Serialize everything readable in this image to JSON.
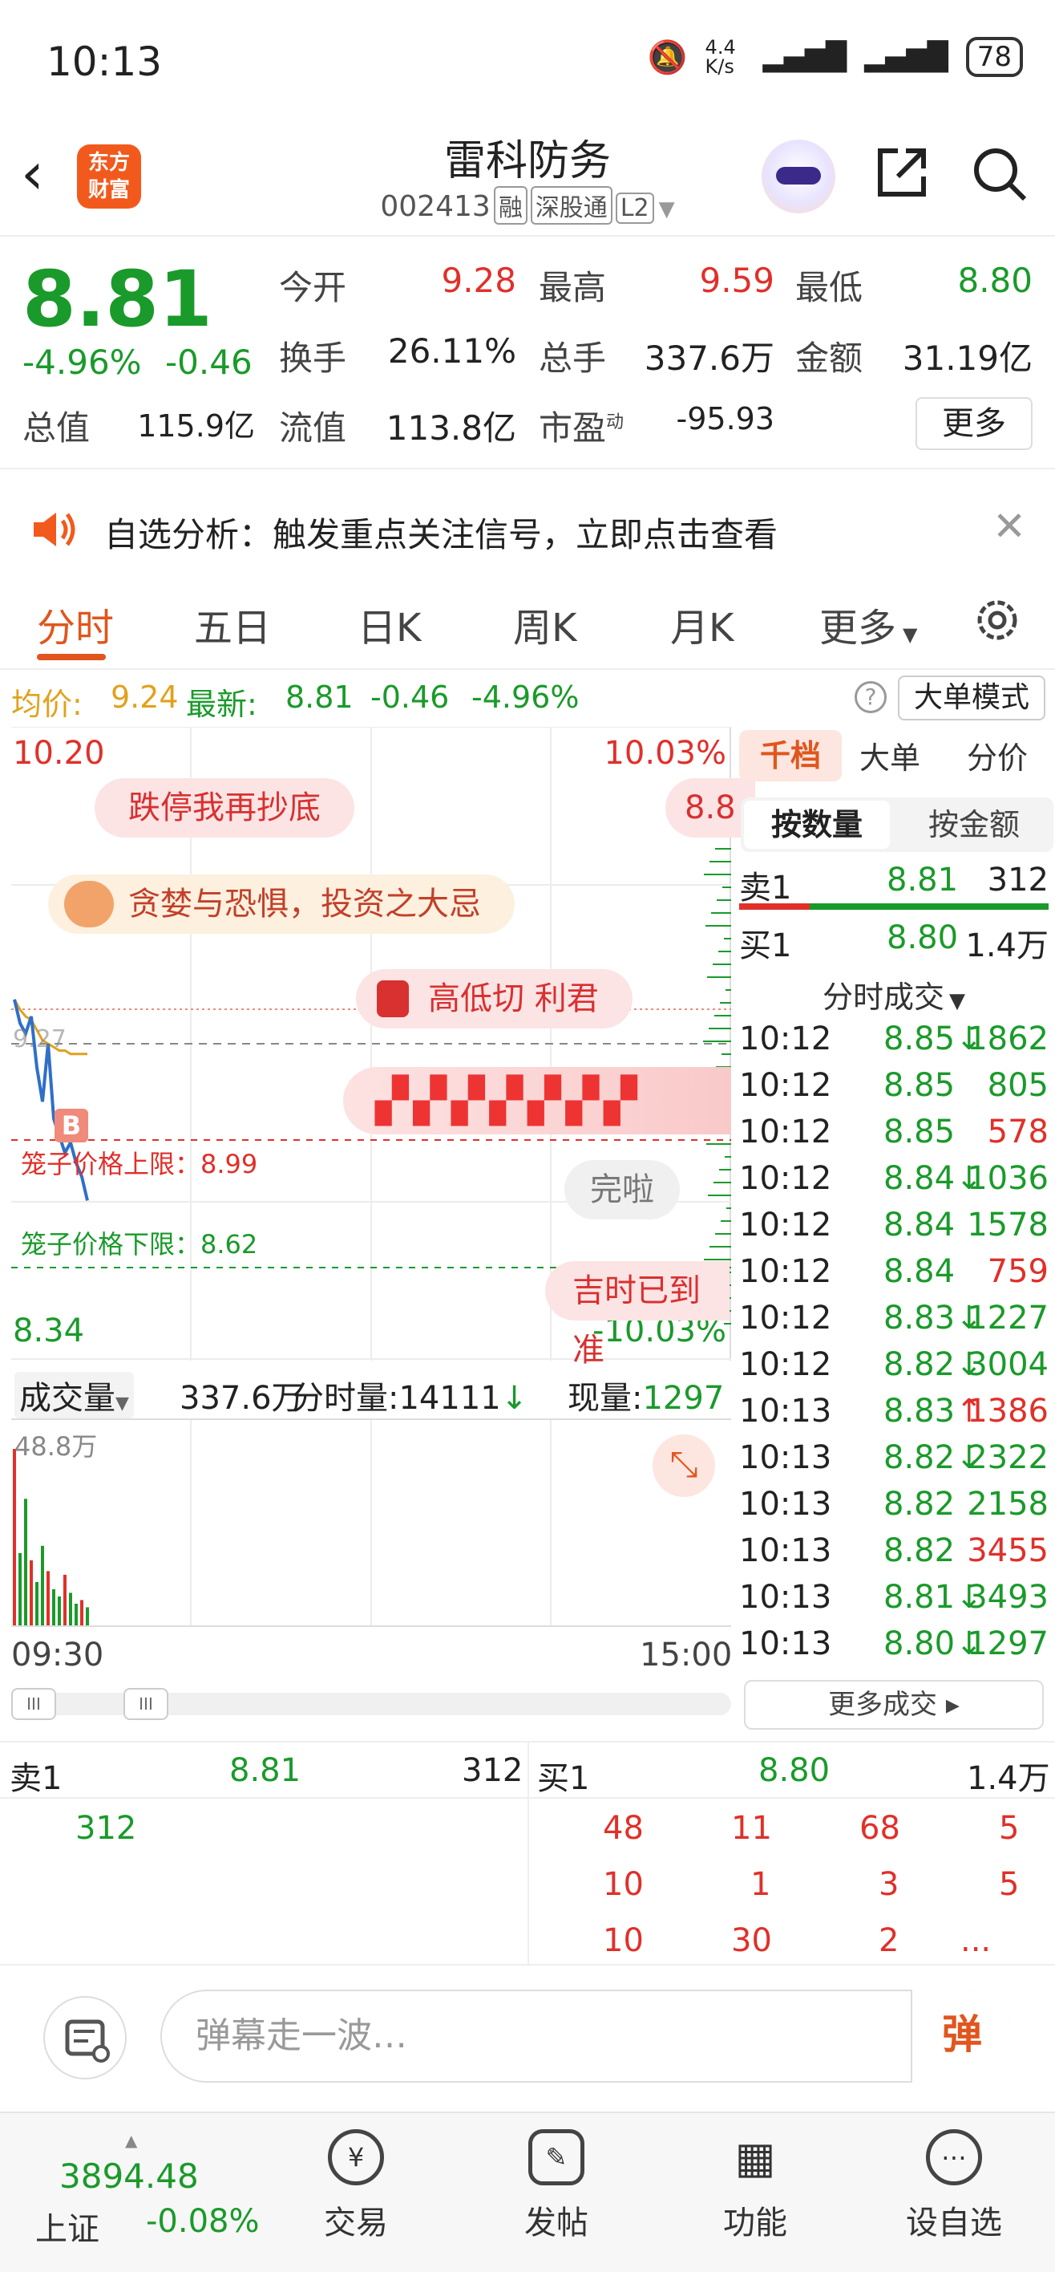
{
  "status": {
    "time": "10:13",
    "net": "4.4 K/s",
    "battery": "78"
  },
  "header": {
    "logo": "东方\n财富",
    "title": "雷科防务",
    "code": "002413",
    "tags": [
      "融",
      "深股通",
      "L2"
    ]
  },
  "quote": {
    "price": "8.81",
    "pct": "-4.96%",
    "chg": "-0.46",
    "open_label": "今开",
    "open": "9.28",
    "high_label": "最高",
    "high": "9.59",
    "low_label": "最低",
    "low": "8.80",
    "turnover_label": "换手",
    "turnover": "26.11%",
    "vol_label": "总手",
    "vol": "337.6万",
    "amount_label": "金额",
    "amount": "31.19亿",
    "mktcap_label": "总值",
    "mktcap": "115.9亿",
    "float_label": "流值",
    "float": "113.8亿",
    "pe_label": "市盈",
    "pe_sup": "动",
    "pe": "-95.93",
    "more": "更多"
  },
  "notice": {
    "text": "自选分析：触发重点关注信号，立即点击查看"
  },
  "tabs": [
    "分时",
    "五日",
    "日K",
    "周K",
    "月K",
    "更多"
  ],
  "avgbar": {
    "avg_label": "均价:",
    "avg": "9.24",
    "latest_label": "最新:",
    "latest": "8.81",
    "chg": "-0.46",
    "pct": "-4.96%",
    "mode_btn": "大单模式"
  },
  "chart": {
    "top_price": "10.20",
    "top_pct": "10.03%",
    "bottom_price": "8.34",
    "bottom_pct": "-10.03%",
    "mid_price": "9.27",
    "upper_limit_label": "笼子价格上限：",
    "upper_limit": "8.99",
    "lower_limit_label": "笼子价格下限：",
    "lower_limit": "8.62",
    "buy_marker": "B",
    "bubbles": [
      "跌停我再抄底",
      "贪婪与恐惧，投资之大忌",
      "高低切 利君",
      "完啦",
      "吉时已到准",
      "8.8"
    ]
  },
  "chart_data": {
    "type": "line",
    "series": [],
    "x": [
      "09:30",
      "09:31",
      "09:32",
      "09:33",
      "09:34",
      "09:35",
      "09:36",
      "09:37",
      "09:38",
      "09:39",
      "09:40",
      "09:41",
      "09:42",
      "09:43"
    ],
    "price": [
      9.4,
      9.33,
      9.3,
      9.35,
      9.2,
      9.1,
      9.27,
      9.05,
      9.0,
      8.95,
      8.98,
      8.92,
      8.88,
      8.81
    ],
    "avg": [
      9.4,
      9.37,
      9.35,
      9.34,
      9.31,
      9.28,
      9.27,
      9.26,
      9.25,
      9.25,
      9.24,
      9.24,
      9.24,
      9.24
    ],
    "volume": [
      48.8,
      20,
      35,
      18,
      12,
      22,
      15,
      10,
      8,
      14,
      9,
      6,
      7,
      5
    ],
    "ylim": [
      8.34,
      10.2
    ],
    "xlim_labels": [
      "09:30",
      "15:00"
    ],
    "vol_max_label": "48.8万"
  },
  "volbar": {
    "label": "成交量",
    "total": "337.6万",
    "fs_label": "分时量:",
    "fs": "14111",
    "cur_label": "现量:",
    "cur": "1297"
  },
  "timeaxis": {
    "start": "09:30",
    "end": "15:00"
  },
  "right": {
    "tabs": [
      "千档",
      "大单",
      "分价"
    ],
    "seg_on": "按数量",
    "seg_off": "按金额",
    "ask_label": "卖1",
    "ask_price": "8.81",
    "ask_qty": "312",
    "bid_label": "买1",
    "bid_price": "8.80",
    "bid_qty": "1.4万",
    "ticks_title": "分时成交",
    "ticks": [
      {
        "t": "10:12",
        "p": "8.85",
        "a": "↓",
        "q": "1862",
        "c": "green"
      },
      {
        "t": "10:12",
        "p": "8.85",
        "a": "",
        "q": "805",
        "c": "green"
      },
      {
        "t": "10:12",
        "p": "8.85",
        "a": "",
        "q": "578",
        "c": "red"
      },
      {
        "t": "10:12",
        "p": "8.84",
        "a": "↓",
        "q": "1036",
        "c": "green"
      },
      {
        "t": "10:12",
        "p": "8.84",
        "a": "",
        "q": "1578",
        "c": "green"
      },
      {
        "t": "10:12",
        "p": "8.84",
        "a": "",
        "q": "759",
        "c": "red"
      },
      {
        "t": "10:12",
        "p": "8.83",
        "a": "↓",
        "q": "1227",
        "c": "green"
      },
      {
        "t": "10:12",
        "p": "8.82",
        "a": "↓",
        "q": "3004",
        "c": "green"
      },
      {
        "t": "10:13",
        "p": "8.83",
        "a": "↑",
        "q": "1386",
        "c": "red"
      },
      {
        "t": "10:13",
        "p": "8.82",
        "a": "↓",
        "q": "2322",
        "c": "green"
      },
      {
        "t": "10:13",
        "p": "8.82",
        "a": "",
        "q": "2158",
        "c": "green"
      },
      {
        "t": "10:13",
        "p": "8.82",
        "a": "",
        "q": "3455",
        "c": "red"
      },
      {
        "t": "10:13",
        "p": "8.81",
        "a": "↓",
        "q": "3493",
        "c": "green"
      },
      {
        "t": "10:13",
        "p": "8.80",
        "a": "↓",
        "q": "1297",
        "c": "green"
      }
    ],
    "more_ticks": "更多成交 ▸"
  },
  "book": {
    "ask_label": "卖1",
    "ask_price": "8.81",
    "ask_qty": "312",
    "bid_label": "买1",
    "bid_price": "8.80",
    "bid_qty": "1.4万",
    "ask_queue": [
      "312"
    ],
    "bid_queue": [
      [
        "48",
        "11",
        "68",
        "5"
      ],
      [
        "10",
        "1",
        "3",
        "5"
      ],
      [
        "10",
        "30",
        "2",
        "..."
      ]
    ]
  },
  "danmu": {
    "placeholder": "弹幕走一波…",
    "btn": "弹"
  },
  "bottom": {
    "index_value": "3894.48",
    "index_name": "上证",
    "index_pct": "-0.08%",
    "items": [
      "交易",
      "发帖",
      "功能",
      "设自选"
    ]
  },
  "colors": {
    "red": "#e0302a",
    "green": "#1a9a2a",
    "accent": "#e0561d"
  }
}
